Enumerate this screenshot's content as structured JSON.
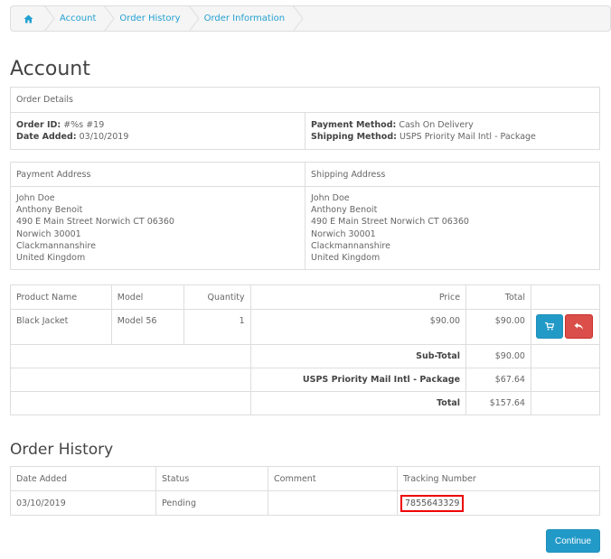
{
  "breadcrumb": {
    "home_icon": "home-icon",
    "items": [
      "Account",
      "Order History",
      "Order Information"
    ]
  },
  "page_title": "Account",
  "order_details": {
    "heading": "Order Details",
    "order_id_label": "Order ID:",
    "order_id_value": "#%s #19",
    "date_added_label": "Date Added:",
    "date_added_value": "03/10/2019",
    "payment_method_label": "Payment Method:",
    "payment_method_value": "Cash On Delivery",
    "shipping_method_label": "Shipping Method:",
    "shipping_method_value": "USPS Priority Mail Intl - Package"
  },
  "addresses": {
    "payment_heading": "Payment Address",
    "shipping_heading": "Shipping Address",
    "payment_lines": [
      "John Doe",
      "Anthony Benoit",
      "490 E Main Street Norwich CT 06360",
      "Norwich 30001",
      "Clackmannanshire",
      "United Kingdom"
    ],
    "shipping_lines": [
      "John Doe",
      "Anthony Benoit",
      "490 E Main Street Norwich CT 06360",
      "Norwich 30001",
      "Clackmannanshire",
      "United Kingdom"
    ]
  },
  "products": {
    "headers": {
      "name": "Product Name",
      "model": "Model",
      "quantity": "Quantity",
      "price": "Price",
      "total": "Total"
    },
    "rows": [
      {
        "name": "Black Jacket",
        "model": "Model 56",
        "quantity": "1",
        "price": "$90.00",
        "total": "$90.00"
      }
    ],
    "reorder_icon": "shopping-cart-icon",
    "return_icon": "reply-icon",
    "totals": [
      {
        "label": "Sub-Total",
        "value": "$90.00"
      },
      {
        "label": "USPS Priority Mail Intl - Package",
        "value": "$67.64"
      },
      {
        "label": "Total",
        "value": "$157.64"
      }
    ]
  },
  "order_history": {
    "title": "Order History",
    "headers": {
      "date": "Date Added",
      "status": "Status",
      "comment": "Comment",
      "tracking": "Tracking Number"
    },
    "rows": [
      {
        "date": "03/10/2019",
        "status": "Pending",
        "comment": "",
        "tracking": "7855643329"
      }
    ]
  },
  "continue_label": "Continue",
  "colors": {
    "link": "#23a1d1",
    "primary": "#229ac8",
    "danger": "#da4f49",
    "highlight": "#e00000"
  }
}
